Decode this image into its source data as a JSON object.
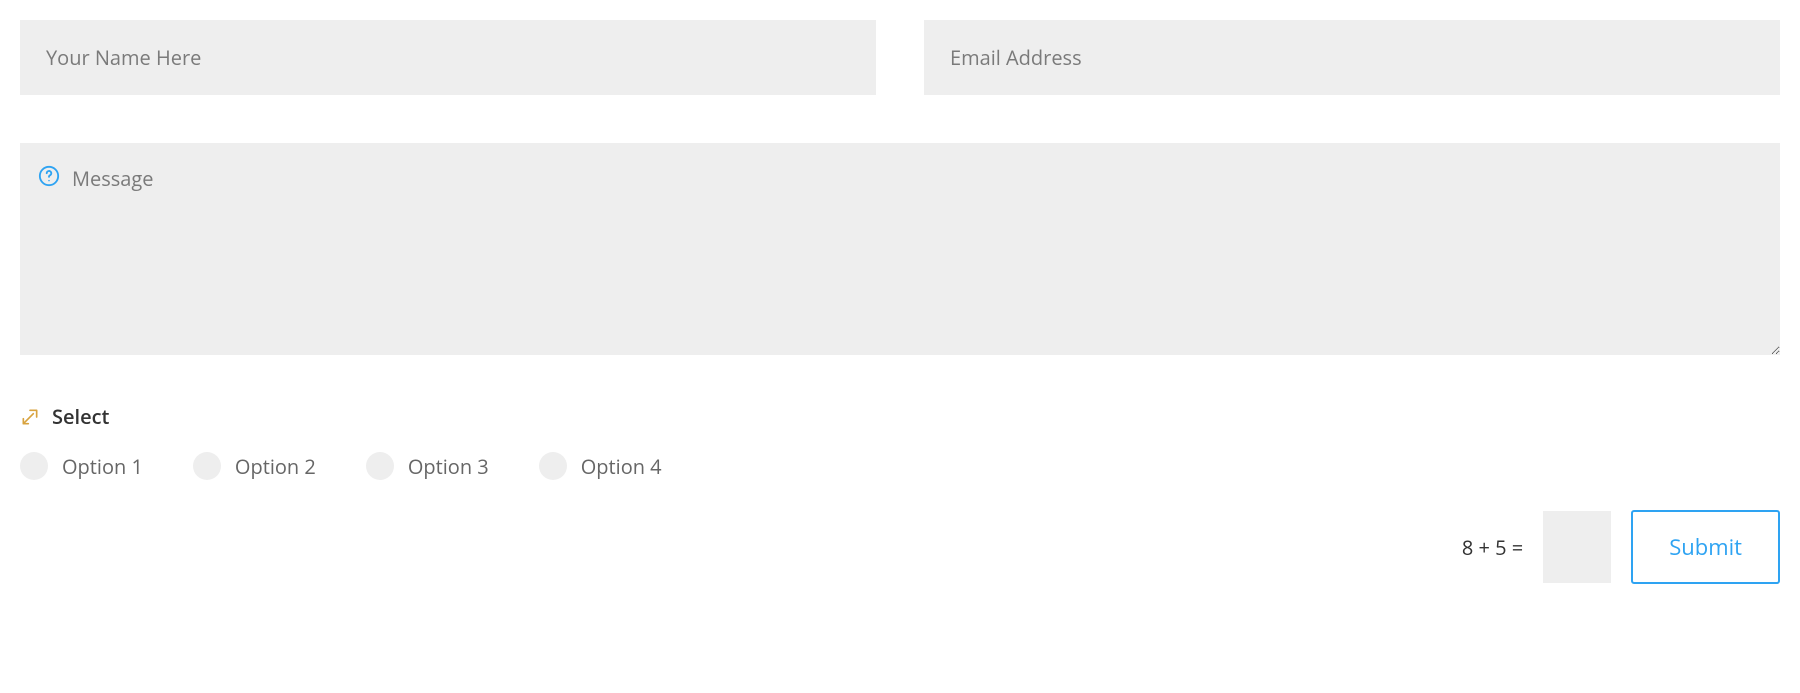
{
  "form": {
    "name": {
      "placeholder": "Your Name Here",
      "value": ""
    },
    "email": {
      "placeholder": "Email Address",
      "value": ""
    },
    "message": {
      "placeholder": "Message",
      "value": ""
    },
    "select": {
      "label": "Select",
      "options": [
        "Option 1",
        "Option 2",
        "Option 3",
        "Option 4"
      ]
    },
    "captcha": {
      "question": "8 + 5 =",
      "value": ""
    },
    "submit_label": "Submit"
  },
  "colors": {
    "accent": "#2ea3f2",
    "input_bg": "#eeeeee",
    "icon_help": "#2ea3f2",
    "icon_select": "#d8a33f"
  }
}
